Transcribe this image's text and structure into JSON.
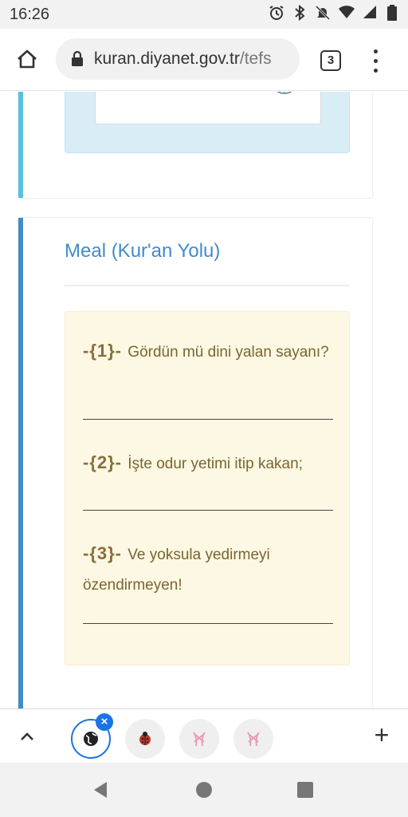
{
  "status_bar": {
    "time": "16:26",
    "icons": [
      "alarm-icon",
      "bluetooth-icon",
      "do-not-disturb-icon",
      "wifi-icon",
      "signal-icon",
      "battery-icon"
    ]
  },
  "browser": {
    "url_host": "kuran.diyanet.gov.tr",
    "url_rest": "/tefs",
    "tab_count": "3"
  },
  "meal_card": {
    "title": "Meal (Kur'an Yolu)",
    "accent_color": "#428bca",
    "verses": [
      {
        "number": "-{1}-",
        "text": "Gördün mü dini yalan sayanı?"
      },
      {
        "number": "-{2}-",
        "text": "İşte odur yetimi itip kakan;"
      },
      {
        "number": "-{3}-",
        "text": "Ve yoksula yedirmeyi özendirmeyen!"
      }
    ]
  },
  "tab_strip": {
    "close_label": "×",
    "new_tab_label": "+",
    "tabs": [
      "globe-icon",
      "ladybug-icon",
      "ballet-icon",
      "ballet-icon"
    ]
  }
}
